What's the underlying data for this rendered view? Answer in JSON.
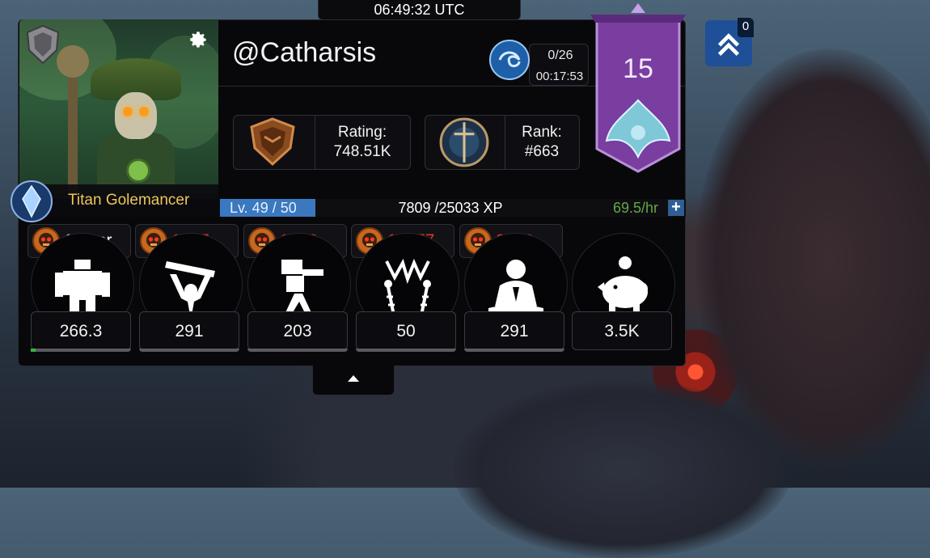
{
  "clock": "06:49:32 UTC",
  "player": {
    "username": "@Catharsis",
    "class_name": "Titan Golemancer",
    "level_label": "Lv. 49 / 50",
    "xp_text": "7809 /25033 XP",
    "xp_rate": "69.5/hr"
  },
  "orb": {
    "count": "0/26",
    "timer": "00:17:53"
  },
  "stats": {
    "rating_label": "Rating:",
    "rating_value": "748.51K",
    "rank_label": "Rank:",
    "rank_value": "#663"
  },
  "banner": {
    "number": "15"
  },
  "resources": [
    {
      "value": "10 per",
      "color": "#ffffff"
    },
    {
      "value": "1767",
      "color": "#e0322a"
    },
    {
      "value": "1000",
      "color": "#e0322a"
    },
    {
      "value": "17677",
      "color": "#e0322a"
    },
    {
      "value": "2062",
      "color": "#e0322a"
    }
  ],
  "slots": [
    {
      "icon": "golem-icon",
      "value": "266.3",
      "progress": 0.05
    },
    {
      "icon": "lifting-hands-icon",
      "value": "291",
      "progress": 0
    },
    {
      "icon": "turret-icon",
      "value": "203",
      "progress": 0
    },
    {
      "icon": "lightning-pylons-icon",
      "value": "50",
      "progress": 0
    },
    {
      "icon": "meditating-figure-icon",
      "value": "291",
      "progress": 0
    },
    {
      "icon": "piggy-bank-icon",
      "value": "3.5K",
      "progress": null
    }
  ],
  "boost": {
    "count": "0"
  },
  "colors": {
    "accent_blue": "#3a78bf",
    "banner_purple": "#7a3da0",
    "gold": "#f0c55a",
    "red": "#e0322a",
    "green": "#63a843"
  }
}
